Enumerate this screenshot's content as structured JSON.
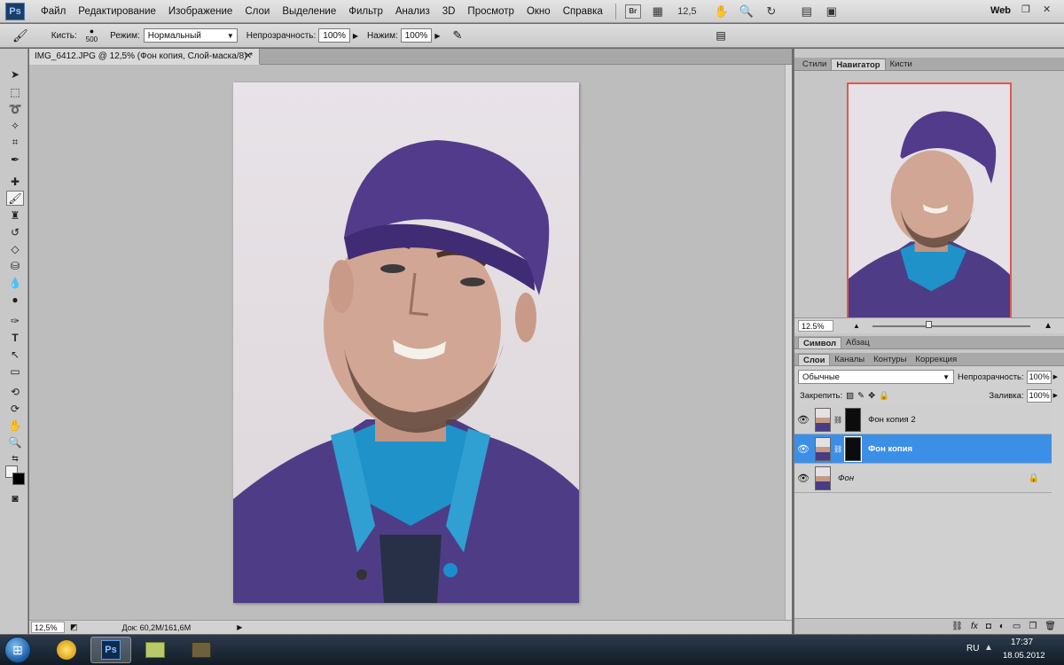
{
  "app": {
    "logo": "Ps",
    "workspace": "Web"
  },
  "menu": [
    "Файл",
    "Редактирование",
    "Изображение",
    "Слои",
    "Выделение",
    "Фильтр",
    "Анализ",
    "3D",
    "Просмотр",
    "Окно",
    "Справка"
  ],
  "menubar": {
    "bridge_label": "Br",
    "zoom": "12,5"
  },
  "options": {
    "brush_label": "Кисть:",
    "brush_size": "500",
    "mode_label": "Режим:",
    "mode_value": "Нормальный",
    "opacity_label": "Непрозрачность:",
    "opacity_value": "100%",
    "flow_label": "Нажим:",
    "flow_value": "100%"
  },
  "document": {
    "tab_title": "IMG_6412.JPG @ 12,5% (Фон копия, Слой-маска/8) *",
    "status_zoom": "12,5%",
    "status_doc": "Док: 60,2M/161,6M"
  },
  "panels": {
    "top_tabs": [
      "Стили",
      "Навигатор",
      "Кисти"
    ],
    "nav_zoom": "12.5%",
    "mid_tabs": [
      "Символ",
      "Абзац"
    ],
    "layer_tabs": [
      "Слои",
      "Каналы",
      "Контуры",
      "Коррекция"
    ],
    "blend_mode": "Обычные",
    "opacity_label": "Непрозрачность:",
    "opacity_value": "100%",
    "lock_label": "Закрепить:",
    "fill_label": "Заливка:",
    "fill_value": "100%"
  },
  "layers": [
    {
      "name": "Фон копия 2",
      "selected": false,
      "mask": true
    },
    {
      "name": "Фон копия",
      "selected": true,
      "mask": true
    },
    {
      "name": "Фон",
      "selected": false,
      "mask": false
    }
  ],
  "taskbar": {
    "lang": "RU",
    "time": "17:37",
    "date": "18.05.2012",
    "ps_label": "Ps"
  },
  "colors": {
    "accent": "#3c8fe7",
    "navigator_frame": "#e2584e"
  }
}
